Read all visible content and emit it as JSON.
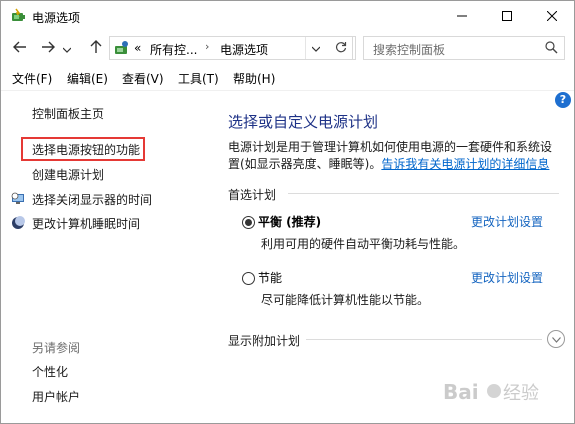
{
  "window": {
    "title": "电源选项",
    "controls": {
      "minimize": "minimize-icon",
      "maximize": "maximize-icon",
      "close": "close-icon"
    }
  },
  "nav": {
    "back": "arrow-left-icon",
    "forward": "arrow-right-icon",
    "recent": "chevron-down-icon",
    "up": "arrow-up-icon",
    "address": {
      "overflow": "«",
      "crumbs": [
        "所有控...",
        "电源选项"
      ]
    },
    "search_placeholder": "搜索控制面板"
  },
  "menu": [
    "文件(F)",
    "编辑(E)",
    "查看(V)",
    "工具(T)",
    "帮助(H)"
  ],
  "sidebar": {
    "items": [
      {
        "label": "控制面板主页"
      },
      {
        "label": "选择电源按钮的功能"
      },
      {
        "label": "创建电源计划"
      },
      {
        "label": "选择关闭显示器的时间"
      },
      {
        "label": "更改计算机睡眠时间"
      }
    ],
    "see_also_title": "另请参阅",
    "see_also": [
      {
        "label": "个性化"
      },
      {
        "label": "用户帐户"
      }
    ]
  },
  "main": {
    "title": "选择或自定义电源计划",
    "description": "电源计划是用于管理计算机如何使用电源的一套硬件和系统设置(如显示器亮度、睡眠等)。",
    "description_link": "告诉我有关电源计划的详细信息",
    "preferred_heading": "首选计划",
    "plans": [
      {
        "name": "平衡 (推荐)",
        "selected": true,
        "description": "利用可用的硬件自动平衡功耗与性能。",
        "link": "更改计划设置"
      },
      {
        "name": "节能",
        "selected": false,
        "description": "尽可能降低计算机性能以节能。",
        "link": "更改计划设置"
      }
    ],
    "additional_heading": "显示附加计划"
  },
  "colors": {
    "highlight_box": "#e53935",
    "link": "#0066cc",
    "title": "#1e3287",
    "help": "#1e6fd0"
  },
  "watermark": "Baidu经验"
}
